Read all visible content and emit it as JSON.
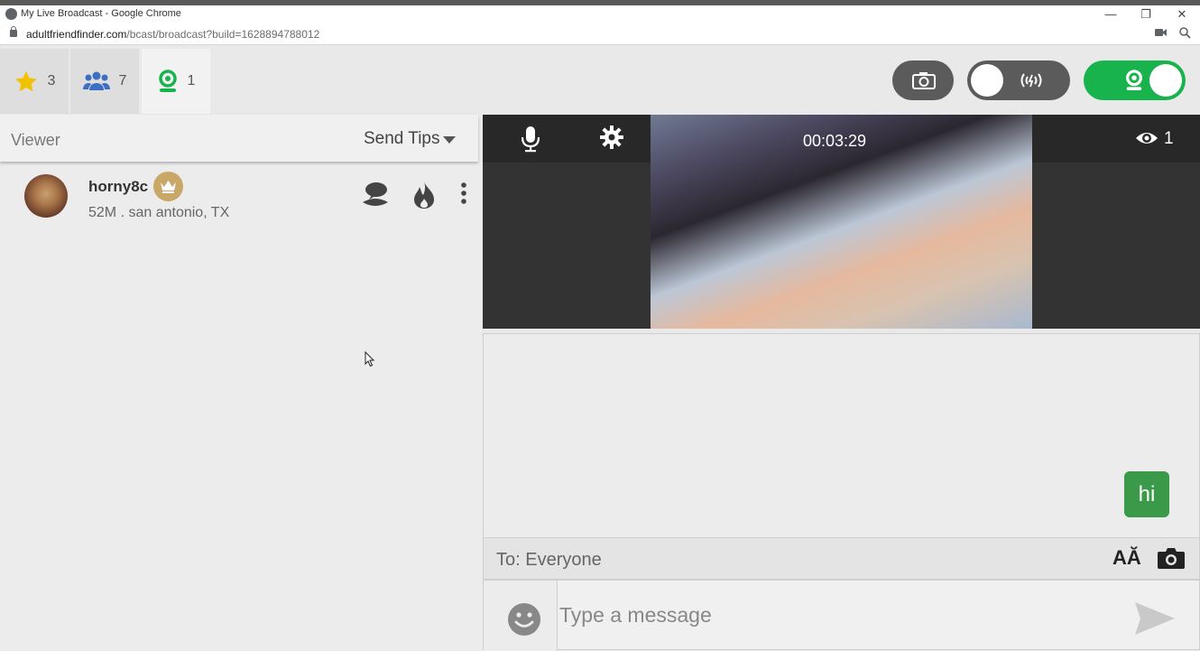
{
  "window": {
    "title": "My Live Broadcast - Google Chrome"
  },
  "address": {
    "host": "adultfriendfinder.com",
    "path": "/bcast/broadcast?build=1628894788012"
  },
  "tabs": [
    {
      "icon": "star-icon",
      "count": "3"
    },
    {
      "icon": "group-icon",
      "count": "7"
    },
    {
      "icon": "webcam-user-icon",
      "count": "1"
    }
  ],
  "viewer_panel": {
    "label": "Viewer",
    "send_tips": "Send Tips",
    "viewers": [
      {
        "username": "horny8c",
        "info": "52M . san antonio, TX"
      }
    ]
  },
  "video": {
    "timer": "00:03:29",
    "viewer_count": "1"
  },
  "chat": {
    "messages": [
      {
        "text": "hi"
      }
    ],
    "to_label": "To: Everyone",
    "font_toggle": "AĂ",
    "input_placeholder": "Type a message"
  },
  "colors": {
    "accent_green": "#19b34d",
    "bubble_green": "#3a9a49",
    "crown_gold": "#c9a766",
    "star_yellow": "#f2c200",
    "group_blue": "#3c6fc4"
  }
}
